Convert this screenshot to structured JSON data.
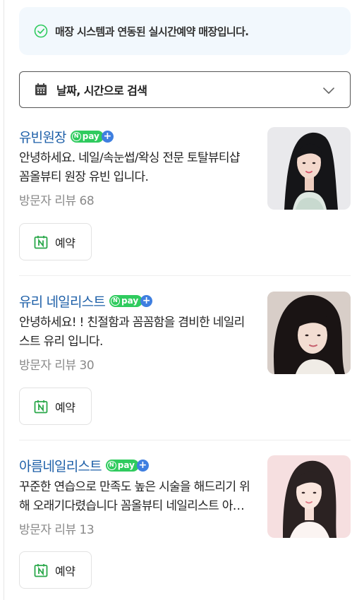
{
  "notice": {
    "text": "매장 시스템과 연동된 실시간예약 매장입니다."
  },
  "date_search": {
    "label": "날짜, 시간으로 검색"
  },
  "badge": {
    "pay_text": "pay",
    "n_letter": "N",
    "plus": "+"
  },
  "colors": {
    "name_link": "#1d5fa8",
    "npay_green": "#2fcb5e",
    "npay_blue": "#3f7fe0",
    "notice_bg": "#f2f8fd",
    "booking_icon_green": "#2aa84a"
  },
  "stylists": [
    {
      "name": "유빈원장",
      "description": "안녕하세요. 네일/속눈썹/왁싱 전문 토탈뷰티샵 꼼올뷰티 원장 유빈 입니다.",
      "reviews": "방문자 리뷰 68",
      "book_label": "예약"
    },
    {
      "name": "유리 네일리스트",
      "description": "안녕하세요! ! 친절함과 꼼꼼함을 겸비한 네일리스트 유리 입니다.",
      "reviews": "방문자 리뷰 30",
      "book_label": "예약"
    },
    {
      "name": "아름네일리스트",
      "description": "꾸준한 연습으로 만족도 높은 시술을 해드리기 위해 오래기다렸습니다 꼼올뷰티 네일리스트 아름입니다.",
      "reviews": "방문자 리뷰 13",
      "book_label": "예약"
    }
  ]
}
